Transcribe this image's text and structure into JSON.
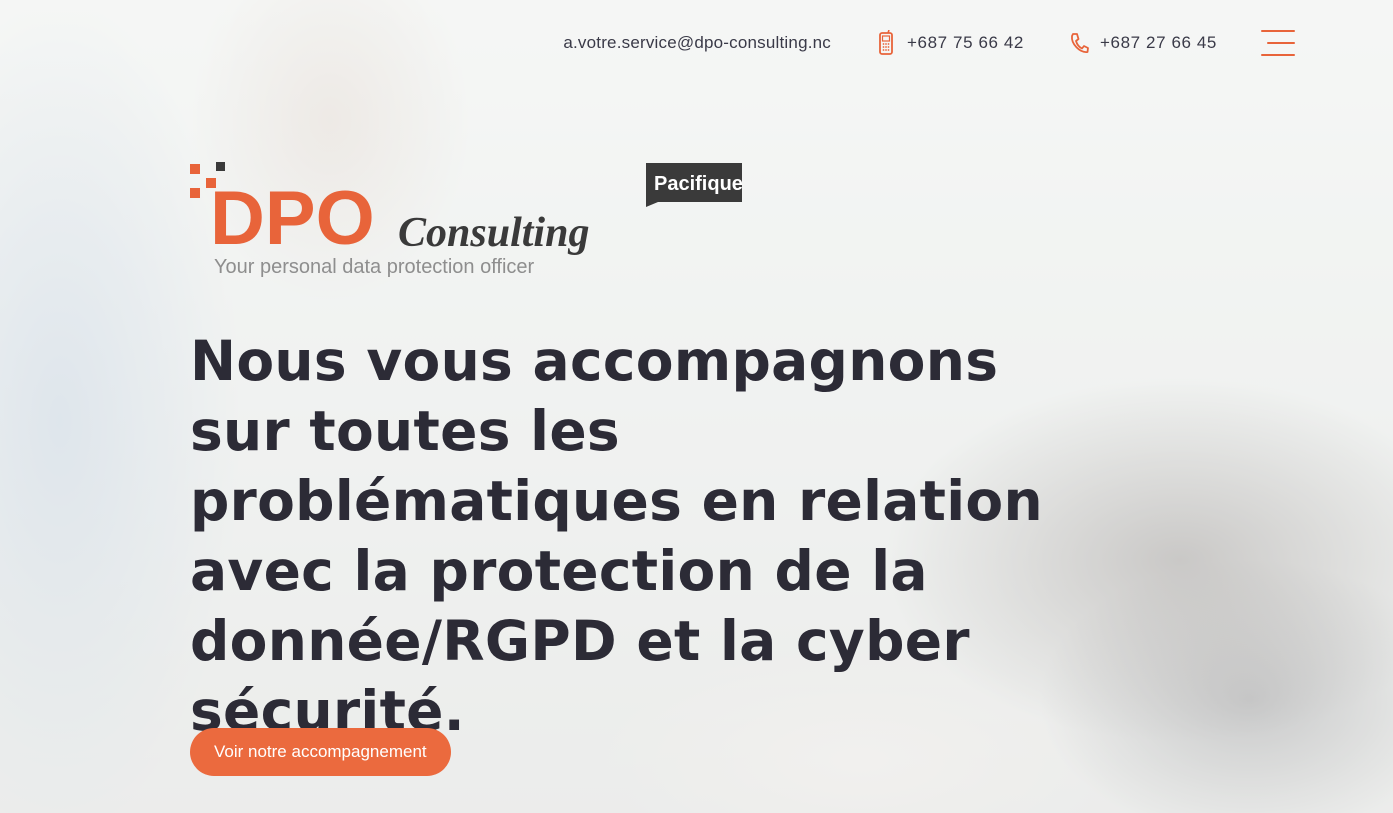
{
  "topbar": {
    "email": "a.votre.service@dpo-consulting.nc",
    "mobile_icon": "mobile-phone-icon",
    "mobile": "+687 75 66 42",
    "landline_icon": "phone-handset-icon",
    "landline": "+687 27 66 45",
    "menu_icon": "hamburger-menu-icon"
  },
  "logo": {
    "brand": "DPO",
    "brand_script": "Consulting",
    "tagline": "Your personal data protection officer",
    "badge": "Pacifique"
  },
  "hero": {
    "headline": "Nous vous accompagnons sur toutes les problématiques en relation avec la protection de la donnée/RGPD et la cyber sécurité.",
    "cta_label": "Voir notre accompagnement"
  },
  "colors": {
    "accent": "#eb6a3e",
    "text_dark": "#2c2b36",
    "badge_bg": "#3a3a3a"
  }
}
